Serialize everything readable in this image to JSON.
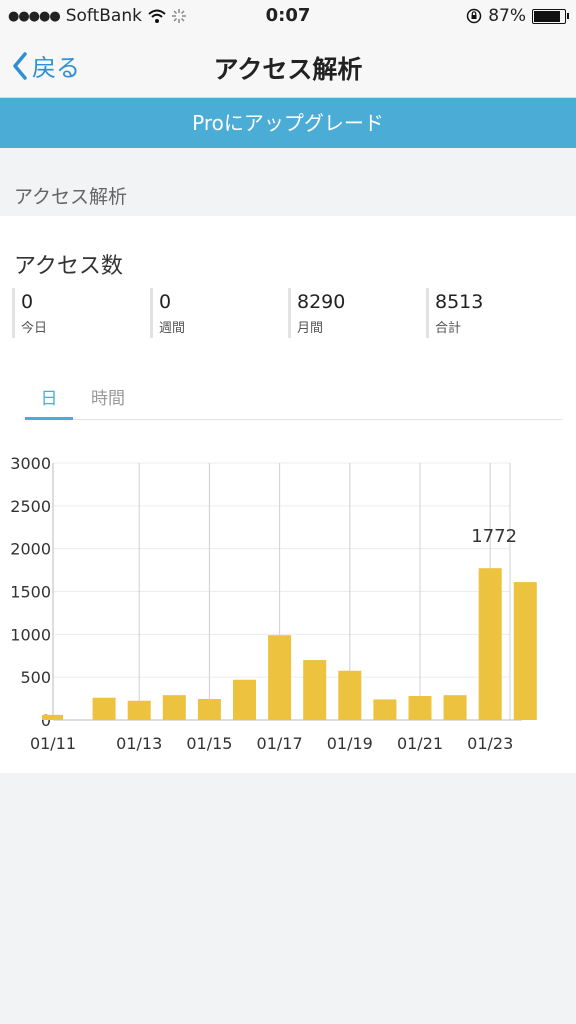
{
  "status_bar": {
    "carrier": "SoftBank",
    "time": "0:07",
    "battery": "87%"
  },
  "nav": {
    "back_label": "戻る",
    "title": "アクセス解析"
  },
  "upgrade_banner": "Proにアップグレード",
  "section_header": "アクセス解析",
  "access": {
    "title": "アクセス数",
    "stats": [
      {
        "value": "0",
        "label": "今日"
      },
      {
        "value": "0",
        "label": "週間"
      },
      {
        "value": "8290",
        "label": "月間"
      },
      {
        "value": "8513",
        "label": "合計"
      }
    ]
  },
  "tabs": {
    "day": "日",
    "hour": "時間"
  },
  "colors": {
    "accent": "#4badd6",
    "bar": "#ecc23f",
    "back": "#2d8fd5"
  },
  "chart_data": {
    "type": "bar",
    "categories": [
      "01/11",
      "01/12",
      "01/13",
      "01/14",
      "01/15",
      "01/16",
      "01/17",
      "01/18",
      "01/19",
      "01/20",
      "01/21",
      "01/22",
      "01/23",
      "01/24"
    ],
    "x_tick_labels": [
      "01/11",
      "01/13",
      "01/15",
      "01/17",
      "01/19",
      "01/21",
      "01/23"
    ],
    "values": [
      60,
      260,
      225,
      290,
      245,
      470,
      990,
      700,
      575,
      240,
      280,
      290,
      1772,
      1610
    ],
    "ylim": [
      0,
      3000
    ],
    "y_ticks": [
      "0",
      "500",
      "1000",
      "1500",
      "2000",
      "2500",
      "3000"
    ],
    "annotation": {
      "index": 12,
      "text": "1772"
    },
    "grid": "vertical lines at labeled dates; horizontal gridlines at y tick values",
    "title": "",
    "xlabel": "",
    "ylabel": ""
  }
}
